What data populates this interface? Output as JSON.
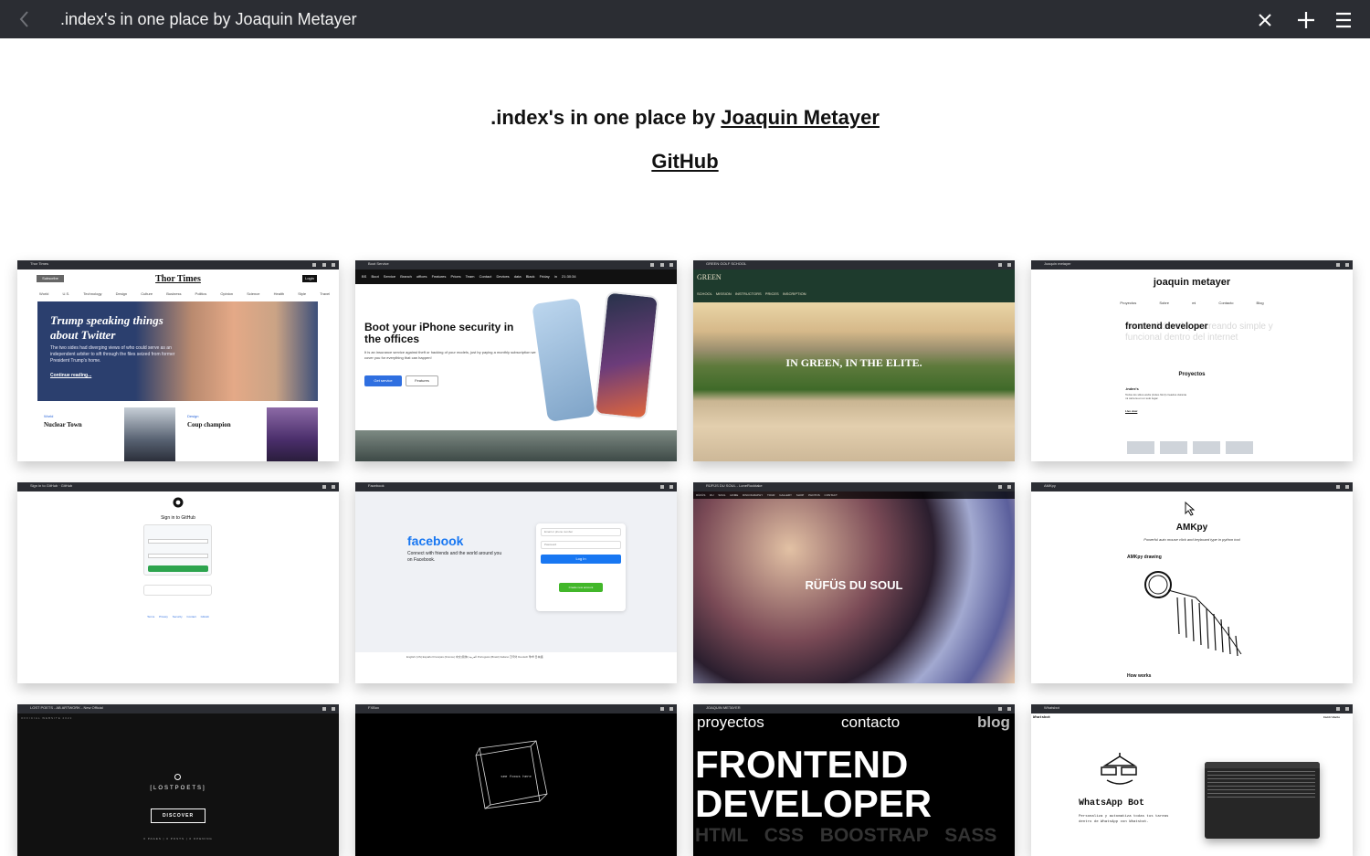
{
  "window": {
    "title": ".index's in one place by Joaquin Metayer"
  },
  "header": {
    "heading_prefix": ".index's in one place by ",
    "heading_link": "Joaquin Metayer",
    "github_link": "GitHub"
  },
  "cards": [
    {
      "window_title": "Thor Times",
      "masthead": "Thor Times",
      "subscribe": "Subscribe",
      "login": "Login",
      "nav": "World U.S. Technology Design Culture Business Politics Opinion Science Health Style Travel",
      "headline": "Trump speaking things about Twitter",
      "summary": "The two sides had diverging views of who could serve as an independent arbiter to sift through the files seized from former President Trump's home.",
      "continue": "Continue reading...",
      "tag1": "World",
      "story1": "Nuclear Town",
      "tag2": "Design",
      "story2": "Coup champion"
    },
    {
      "window_title": "Boot Service",
      "nav": "BS  Boot Service  Branch offices  Features  Prices  Team  Contact  Devices data  Black Friday in 21:30:34",
      "headline": "Boot your iPhone security in the offices",
      "summary": "It is an insurance service against theft or hacking of your models, just by paying a monthly subscription we cover you for everything that can happen!",
      "primary_button": "Get service",
      "secondary_button": "Features"
    },
    {
      "window_title": "GREEN GOLF SCHOOL",
      "logo": "GREEN",
      "nav": "SCHOOL  MISSION  INSTRUCTORS  PRICES  INSCRIPTION",
      "tagline": "IN GREEN, IN THE ELITE."
    },
    {
      "window_title": "Joaquin metayer",
      "name": "joaquin metayer",
      "menu": "Proyectos Sobre mi Contacto Blog",
      "role": "frontend developer",
      "role_rest": "frontend developer creando simple y funcional dentro del internet",
      "projects_title": "Proyectos",
      "project_name": ".index's",
      "project_desc": "Todos los sitios webs (index.html) creados durante mi carrera en un solo lugar.",
      "project_link": "Live view"
    },
    {
      "window_title": "Sign in to GitHub · GitHub",
      "heading": "Sign in to GitHub",
      "footer": "Terms Privacy Security Contact GitHub"
    },
    {
      "window_title": "Facebook",
      "logo": "facebook",
      "tagline": "Connect with friends and the world around you on Facebook.",
      "email_placeholder": "Email or phone number",
      "password_placeholder": "Password",
      "login_button": "Log In",
      "create_button": "Create new account",
      "languages": "English (US) Español Français (France) 中文(简体) العربية Português (Brasil) Italiano 한국어 Deutsch हिन्दी 日本語"
    },
    {
      "window_title": "RÜFÜS DU SOUL - LoneRocktake",
      "nav": "RÜFÜS DU SOUL  HOME  DISCOGRAPHY  TOUR  GALLERY SHOP  PHOTOS  CONTACT",
      "title": "RÜFÜS DU SOUL"
    },
    {
      "window_title": "AMKpy",
      "title": "AMKpy",
      "subtitle": "Powerful auto mouse click and keyboard type in python tool",
      "drawing": "AMKpy drawing",
      "how": "How works"
    },
    {
      "window_title": "LOST POETS - AB ARTWORK - New Official",
      "top_label": "OFFICIAL WEBSITE 2022",
      "brand": "[LOSTPOETS]",
      "discover": "DISCOVER",
      "stats": "0 PAGES | 0 POSTS | 0 OPENING"
    },
    {
      "window_title": "FXBox",
      "text": "see focus here"
    },
    {
      "window_title": "JOAQUIN METAYER",
      "nav1": "proyectos",
      "nav2": "contacto",
      "nav3": "blog",
      "big": "FRONTEND DEVELOPER",
      "skills": "HTML CSS BOOSTRAP SASS"
    },
    {
      "window_title": "Whatsbot",
      "top_left": "Whatsbot",
      "top_right": "Contribute",
      "name": "WhatsApp Bot",
      "desc": "Personaliza y automatiza todas tus tareas dentro de WhatsApp con Whatsbot."
    }
  ]
}
